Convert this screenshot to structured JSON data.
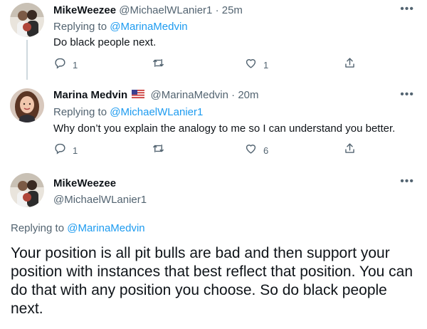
{
  "tweets": [
    {
      "display_name": "MikeWeezee",
      "handle": "@MichaelWLanier1",
      "separator": "·",
      "time": "25m",
      "replying_prefix": "Replying to",
      "replying_to": "@MarinaMedvin",
      "text": "Do black people next.",
      "replies": "1",
      "retweets": "",
      "likes": "1"
    },
    {
      "display_name": "Marina Medvin",
      "handle": "@MarinaMedvin",
      "separator": "·",
      "time": "20m",
      "replying_prefix": "Replying to",
      "replying_to": "@MichaelWLanier1",
      "text": "Why don’t you explain the analogy to me so I can understand you better.",
      "replies": "1",
      "retweets": "",
      "likes": "6"
    }
  ],
  "main_tweet": {
    "display_name": "MikeWeezee",
    "handle": "@MichaelWLanier1",
    "replying_prefix": "Replying to",
    "replying_to": "@MarinaMedvin",
    "text": "Your position is all pit bulls are bad and then support your position with instances that best reflect that position. You can do that with any position you choose. So do black people next."
  },
  "icons": {
    "reply": "reply-icon",
    "retweet": "retweet-icon",
    "like": "heart-icon",
    "share": "share-icon",
    "more": "more-icon",
    "flag": "us-flag-icon"
  },
  "colors": {
    "text": "#0f1419",
    "secondary": "#536471",
    "link": "#1d9bf0",
    "thread_line": "#cfd9de"
  }
}
